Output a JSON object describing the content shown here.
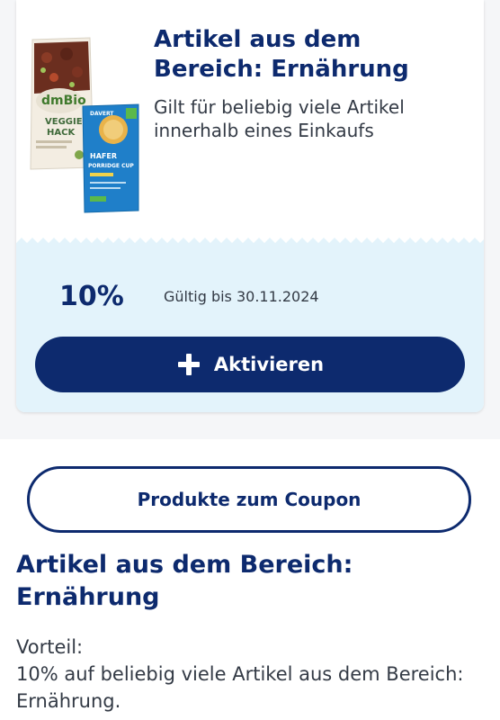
{
  "coupon": {
    "title": "Artikel aus dem Bereich: Ernährung",
    "description": "Gilt für beliebig viele Artikel innerhalb eines Einkaufs",
    "discount": "10%",
    "validity": "Gültig bis 30.11.2024",
    "activate_label": "Aktivieren",
    "activate_icon": "plus-icon",
    "products": {
      "left": {
        "brand": "dmBio",
        "name_line1": "VEGGIE",
        "name_line2": "HACK"
      },
      "right": {
        "brand": "DAVERT",
        "name_line1": "HAFER",
        "name_line2": "PORRIDGE CUP"
      }
    }
  },
  "products_button": {
    "label": "Produkte zum Coupon"
  },
  "detail": {
    "title": "Artikel aus dem Bereich: Ernährung",
    "benefit_label": "Vorteil:",
    "benefit_text": "10% auf beliebig viele Artikel aus dem Bereich: Ernährung."
  },
  "colors": {
    "primary": "#0d2a6e",
    "coupon_lower_bg": "#e3f3fb",
    "page_bg": "#f5f6f8",
    "text": "#333a45"
  }
}
